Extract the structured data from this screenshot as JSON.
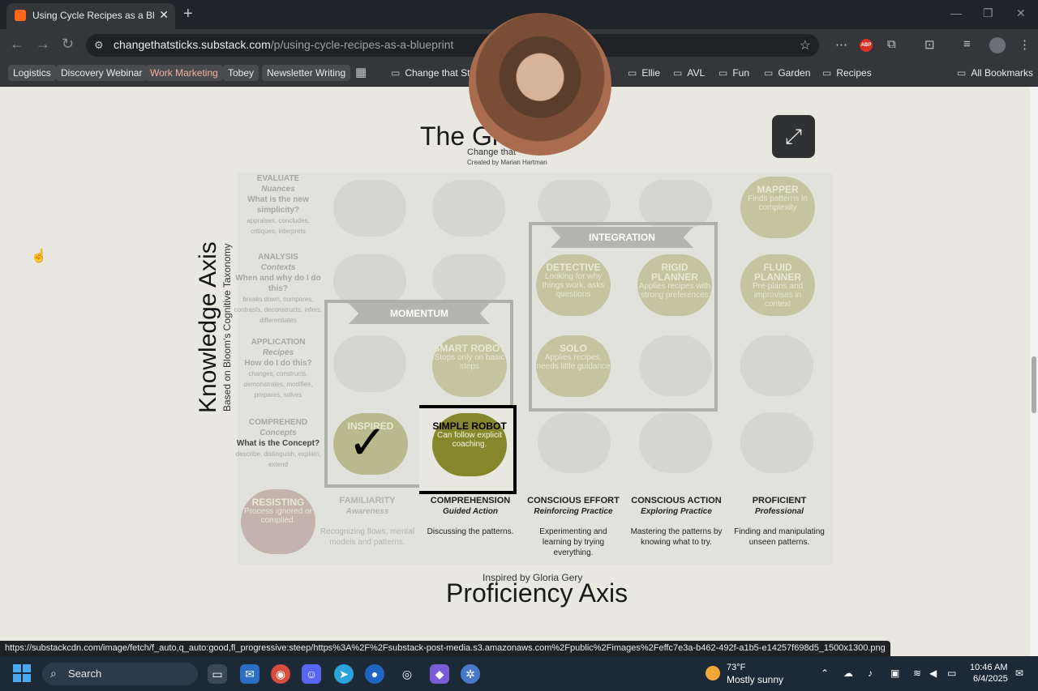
{
  "browser": {
    "tab_title": "Using Cycle Recipes as a Blueprint",
    "new_tab": "+",
    "close_tab": "✕",
    "url_domain": "changethatsticks.substack.com",
    "url_path": "/p/using-cycle-recipes-as-a-blueprint",
    "abp_label": "ABP",
    "window": {
      "minimize": "—",
      "restore": "❐",
      "close": "✕"
    }
  },
  "bookmarks": {
    "chips": [
      "Logistics",
      "Discovery Webinar",
      "Work Marketing",
      "Tobey",
      "Newsletter Writing"
    ],
    "folders": [
      "Change that Sticks",
      "Ellie",
      "AVL",
      "Fun",
      "Garden",
      "Recipes"
    ],
    "all_bookmarks": "All Bookmarks"
  },
  "grid": {
    "title": "The Grid",
    "subtitle": "Change that",
    "credit": "Created by Marian Hartman",
    "knowledge_axis": "Knowledge Axis",
    "knowledge_axis_sub": "Based on Bloom's Cognitive Taxonomy",
    "proficiency_credit": "Inspired by Gloria Gery",
    "proficiency_axis": "Proficiency Axis",
    "levels": [
      {
        "h": "EVALUATE",
        "i": "Nuances",
        "q": "What is the new simplicity?",
        "v": "appraises, concludes, critiques, interprets"
      },
      {
        "h": "ANALYSIS",
        "i": "Contexts",
        "q": "When and why do I do this?",
        "v": "breaks down, compares, contrasts, deconstructs, infers, differentiates"
      },
      {
        "h": "APPLICATION",
        "i": "Recipes",
        "q": "How do I do this?",
        "v": "changes, constructs, demonstrates, modifies, prepares, solves"
      },
      {
        "h": "COMPREHEND",
        "i": "Concepts",
        "q": "What is the Concept?",
        "v": "describe, distinguish, explain, extend"
      }
    ],
    "columns": [
      {
        "h": "FAMILIARITY",
        "s": "Awareness",
        "d": "Recognizing flows, mental models and patterns."
      },
      {
        "h": "COMPREHENSION",
        "s": "Guided Action",
        "d": "Discussing the patterns."
      },
      {
        "h": "CONSCIOUS EFFORT",
        "s": "Reinforcing Practice",
        "d": "Experimenting and learning by trying everything."
      },
      {
        "h": "CONSCIOUS ACTION",
        "s": "Exploring Practice",
        "d": "Mastering the patterns by knowing what to try."
      },
      {
        "h": "PROFICIENT",
        "s": "Professional",
        "d": "Finding and manipulating unseen patterns."
      }
    ],
    "nodes": {
      "resisting": {
        "t": "RESISTING",
        "d": "Process ignored or complied."
      },
      "inspired": {
        "t": "INSPIRED",
        "check": "✓"
      },
      "simple_robot": {
        "t": "SIMPLE ROBOT",
        "d": "Can follow explicit coaching."
      },
      "smart_robot": {
        "t": "SMART ROBOT",
        "d": "Stops only on basic steps"
      },
      "solo": {
        "t": "SOLO",
        "d": "Applies recipes, needs little guidance"
      },
      "detective": {
        "t": "DETECTIVE",
        "d": "Looking for why things work, asks questions"
      },
      "rigid_planner": {
        "t": "RIGID PLANNER",
        "d": "Applies recipes with strong preferences"
      },
      "fluid_planner": {
        "t": "FLUID PLANNER",
        "d": "Pre-plans and improvises in context"
      },
      "mapper": {
        "t": "MAPPER",
        "d": "Finds patterns in complexity"
      }
    },
    "banners": {
      "momentum": "MOMENTUM",
      "integration": "INTEGRATION"
    },
    "expand_icon": "⤢"
  },
  "status_url": "https://substackcdn.com/image/fetch/f_auto,q_auto:good,fl_progressive:steep/https%3A%2F%2Fsubstack-post-media.s3.amazonaws.com%2Fpublic%2Fimages%2Feffc7e3a-b462-492f-a1b5-e14257f698d5_1500x1300.png",
  "taskbar": {
    "search": "Search",
    "weather_temp": "73°F",
    "weather_desc": "Mostly sunny",
    "time": "10:46 AM",
    "date": "6/4/2025"
  }
}
